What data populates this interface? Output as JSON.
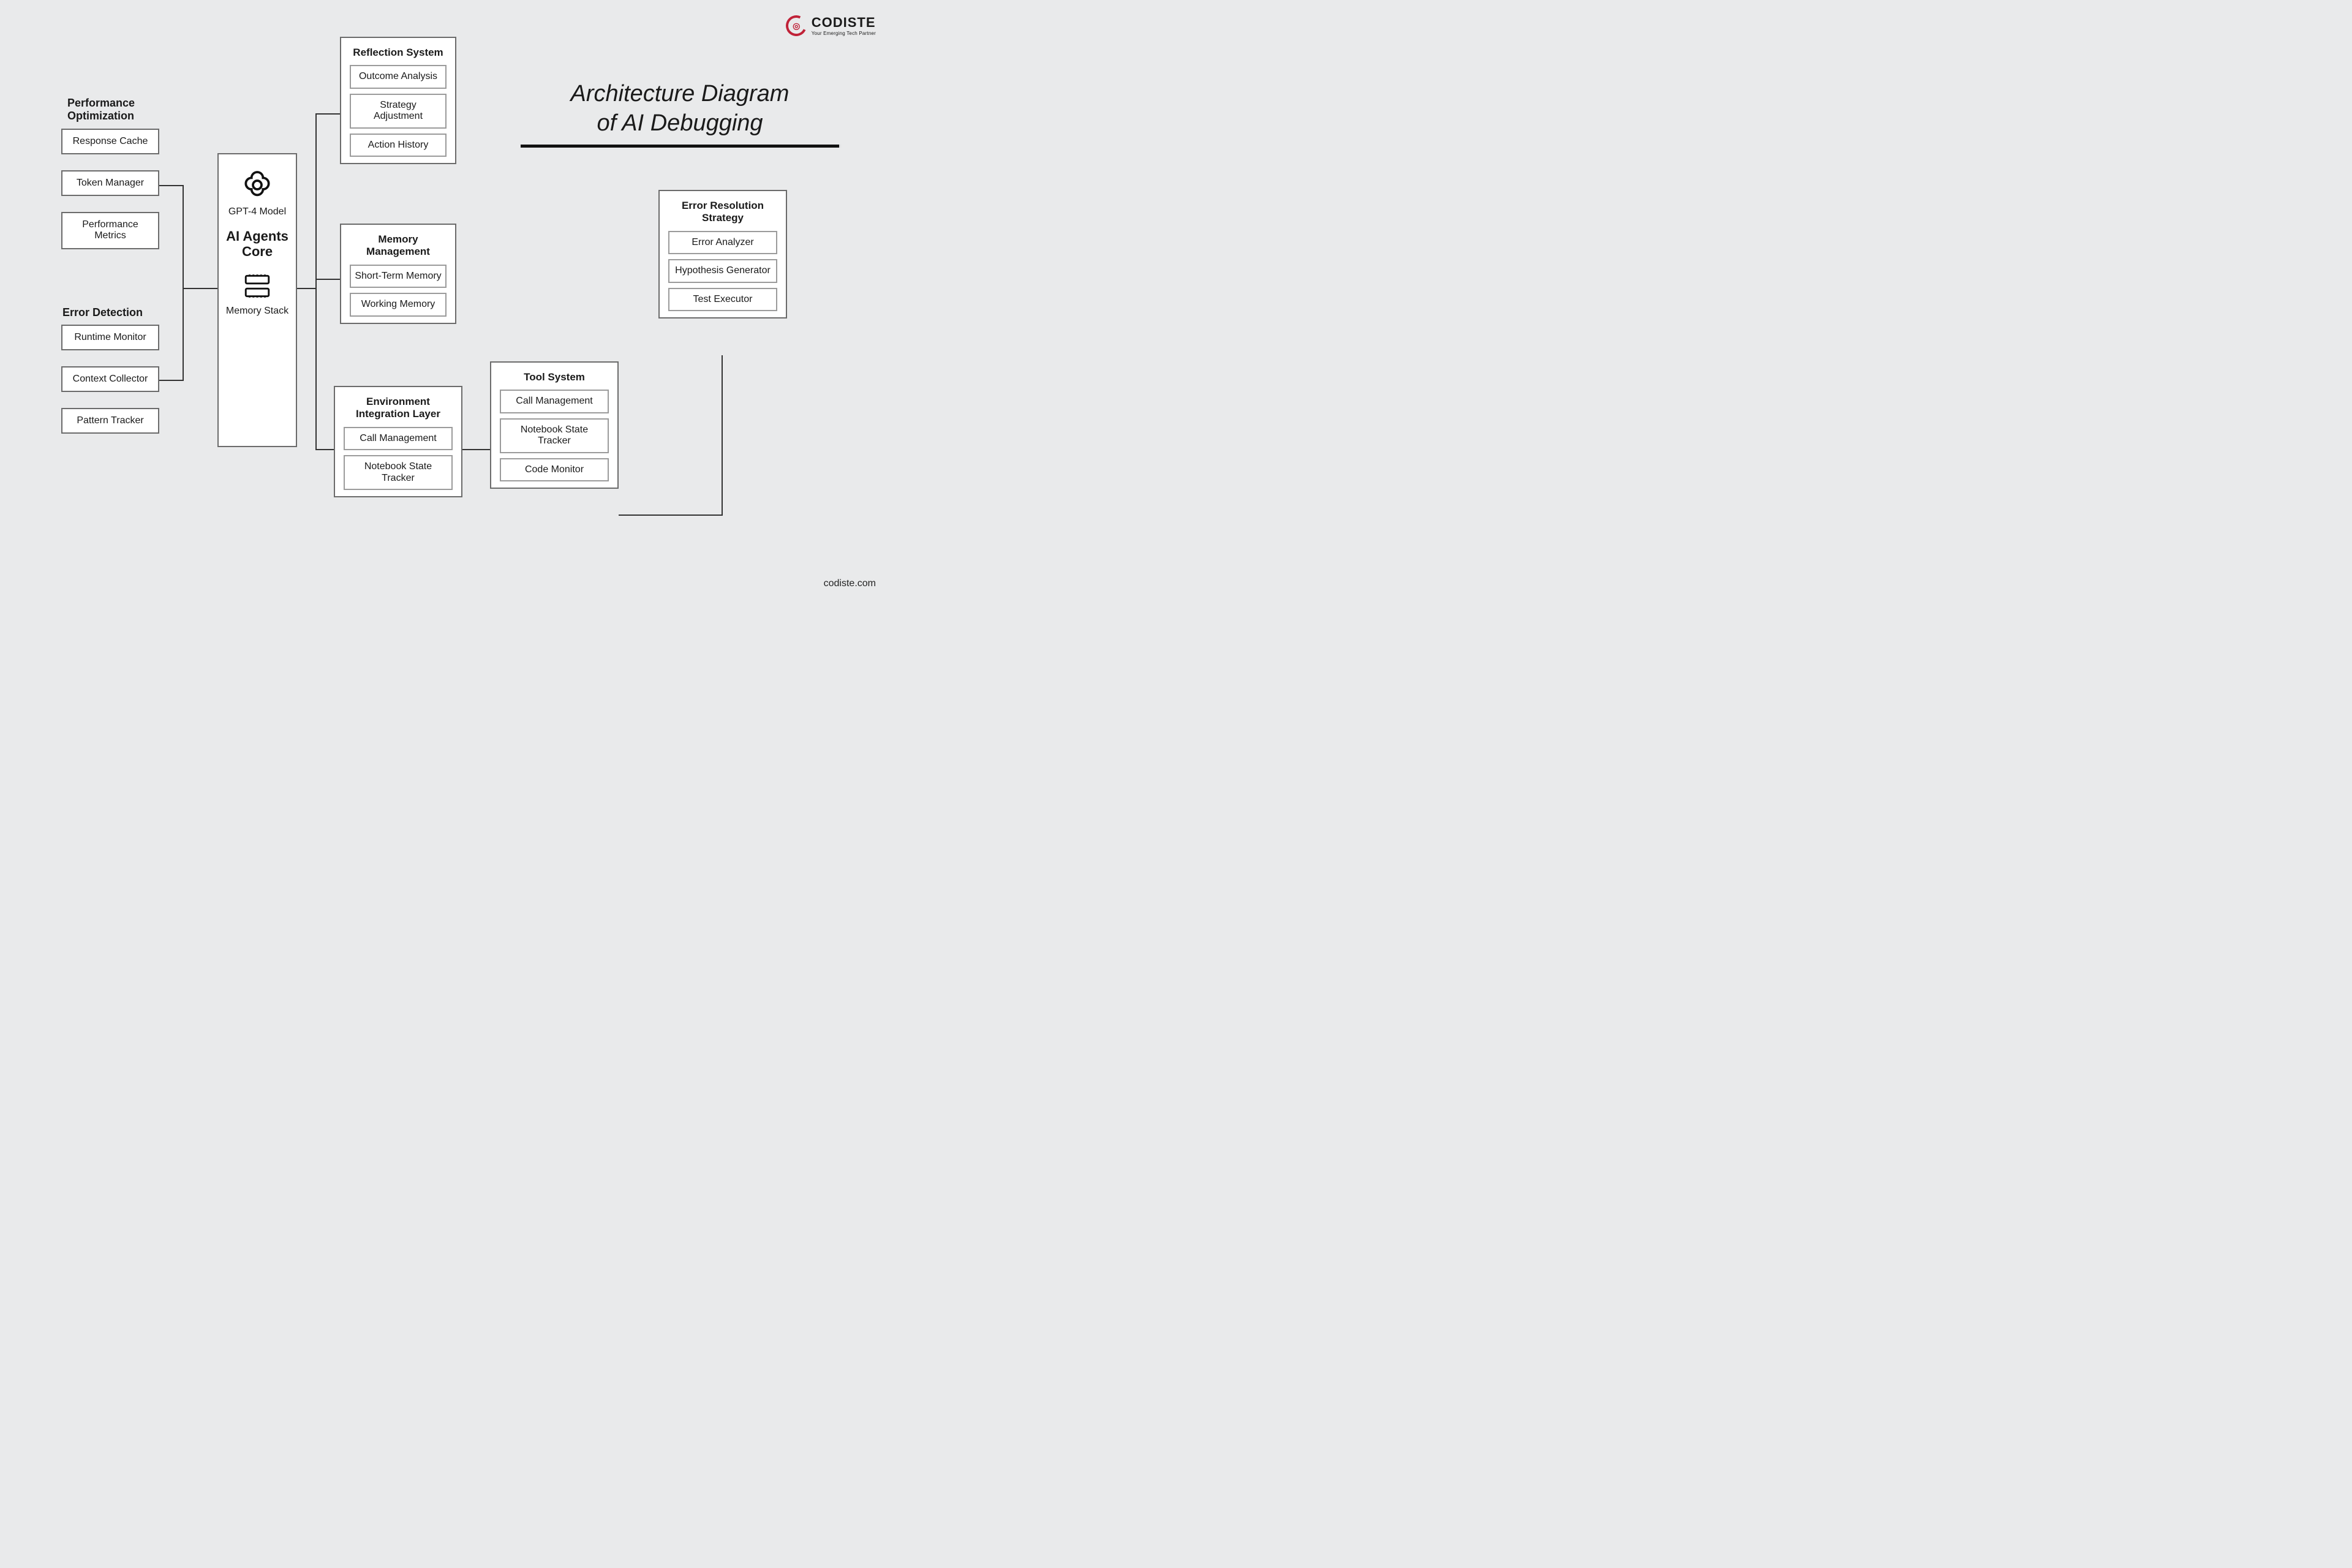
{
  "brand": {
    "name": "CODISTE",
    "tagline": "Your Emerging Tech Partner",
    "site": "codiste.com"
  },
  "title": {
    "line1": "Architecture Diagram",
    "line2": "of AI Debugging"
  },
  "core": {
    "model_label": "GPT-4 Model",
    "center_label": "AI Agents Core",
    "memory_label": "Memory Stack"
  },
  "perf": {
    "heading": "Performance Optimization",
    "items": [
      "Response Cache",
      "Token Manager",
      "Performance Metrics"
    ]
  },
  "error_detect": {
    "heading": "Error Detection",
    "items": [
      "Runtime Monitor",
      "Context Collector",
      "Pattern Tracker"
    ]
  },
  "reflection": {
    "heading": "Reflection System",
    "items": [
      "Outcome Analysis",
      "Strategy Adjustment",
      "Action History"
    ]
  },
  "memory_mgmt": {
    "heading": "Memory Management",
    "items": [
      "Short-Term Memory",
      "Working Memory"
    ]
  },
  "env": {
    "heading": "Environment Integration Layer",
    "items": [
      "Call Management",
      "Notebook State Tracker"
    ]
  },
  "tool": {
    "heading": "Tool System",
    "items": [
      "Call Management",
      "Notebook State Tracker",
      "Code Monitor"
    ]
  },
  "resolution": {
    "heading": "Error Resolution Strategy",
    "items": [
      "Error Analyzer",
      "Hypothesis Generator",
      "Test Executor"
    ]
  }
}
